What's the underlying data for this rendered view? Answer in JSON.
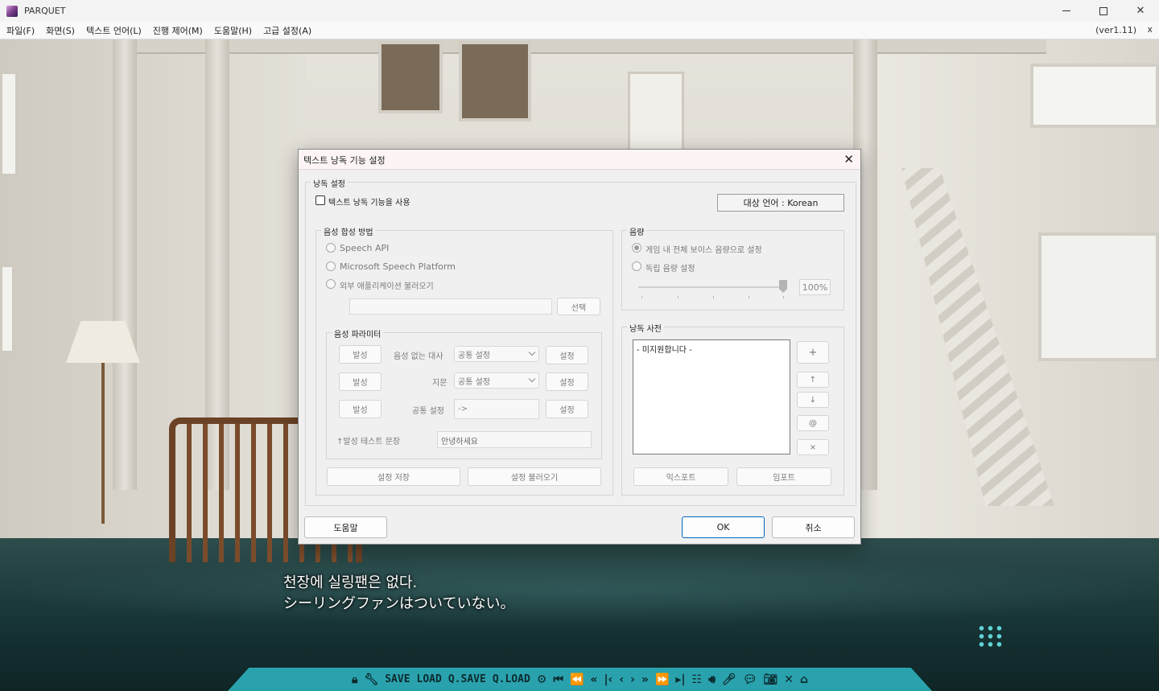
{
  "window": {
    "title": "PARQUET",
    "version": "(ver1.11)",
    "menu_close": "x"
  },
  "menu": [
    "파일(F)",
    "화면(S)",
    "텍스트 언어(L)",
    "진행 제어(M)",
    "도움말(H)",
    "고급 설정(A)"
  ],
  "scene": {
    "dialogue_line1": "천장에 실링팬은 없다.",
    "dialogue_line2": "シーリングファンはついていない。"
  },
  "toolbar": {
    "save": "SAVE",
    "load": "LOAD",
    "qsave": "Q.SAVE",
    "qload": "Q.LOAD"
  },
  "dialog": {
    "title": "텍스트 낭독 기능 설정",
    "read_settings_label": "낭독 설정",
    "enable_label": "텍스트 낭독 기능을 사용",
    "target_language": "대상 언어 : Korean",
    "synthesis": {
      "label": "음성 합성 방법",
      "options": [
        "Speech API",
        "Microsoft Speech Platform",
        "외부 애플리케이션 불러오기"
      ],
      "select_button": "선택"
    },
    "params": {
      "label": "음성 파라미터",
      "rows": [
        {
          "speak": "발성",
          "name": "음성 없는 대사",
          "value": "공통 설정",
          "set": "설정"
        },
        {
          "speak": "발성",
          "name": "지문",
          "value": "공통 설정",
          "set": "설정"
        },
        {
          "speak": "발성",
          "name": "공통 설정",
          "value": "->",
          "set": "설정"
        }
      ],
      "test_label": "↑발성 테스트 문장",
      "test_value": "안녕하세요",
      "save_button": "설정 저장",
      "load_button": "설정 불러오기"
    },
    "volume": {
      "label": "음량",
      "option_game": "게임 내 전체 보이스 음량으로 설정",
      "option_independent": "독립 음량 설정",
      "percent": "100%"
    },
    "dictionary": {
      "label": "낭독 사전",
      "item": "- 미지원합니다 -",
      "add": "+",
      "up": "↑",
      "down": "↓",
      "at": "@",
      "remove": "×",
      "export": "익스포트",
      "import": "임포트"
    },
    "help_button": "도움말",
    "ok_button": "OK",
    "cancel_button": "취소"
  }
}
